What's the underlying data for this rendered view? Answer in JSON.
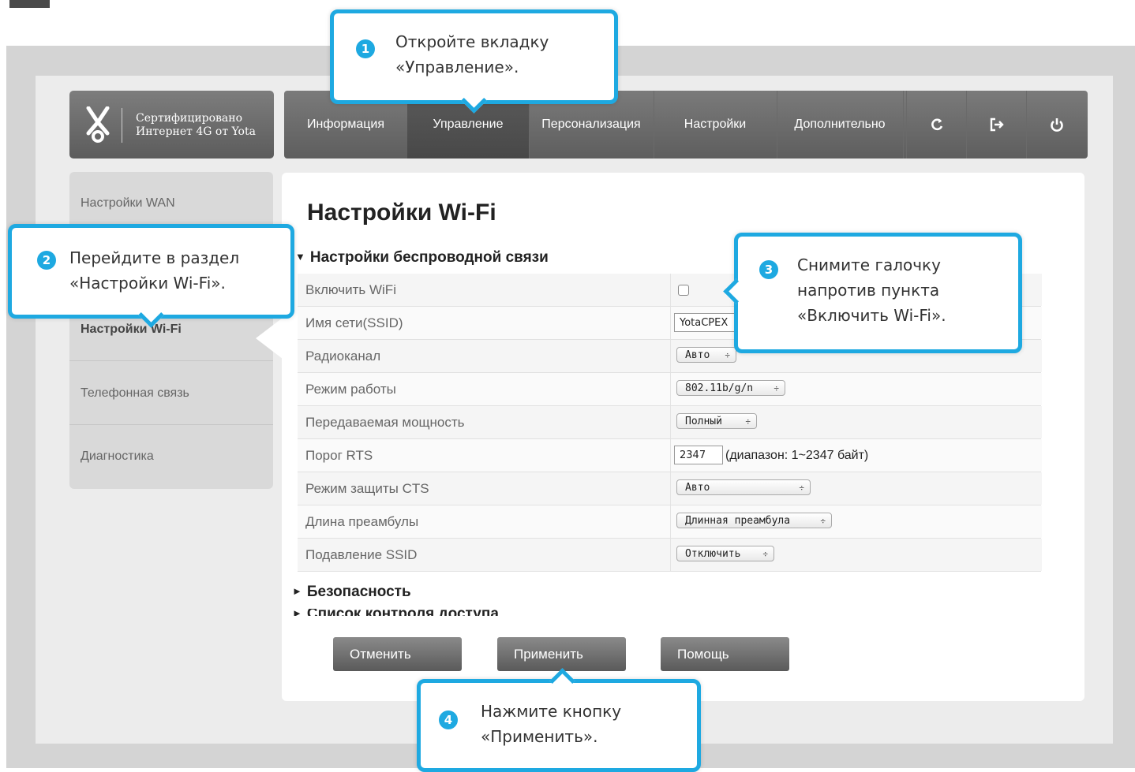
{
  "logo": {
    "line1": "Сертифицировано",
    "line2": "Интернет 4G от Yota"
  },
  "topnav": {
    "tabs": [
      {
        "label": "Информация"
      },
      {
        "label": "Управление"
      },
      {
        "label": "Персонализация"
      },
      {
        "label": "Настройки"
      },
      {
        "label": "Дополнительно"
      }
    ],
    "active_tab": "Управление",
    "icons": [
      "refresh-icon",
      "logout-icon",
      "power-icon"
    ]
  },
  "sidebar": {
    "items": [
      {
        "label": "Настройки WAN"
      },
      {
        "label": "Настройки Wi-Fi"
      },
      {
        "label": "Телефонная связь"
      },
      {
        "label": "Диагностика"
      }
    ],
    "active_item": "Настройки Wi-Fi"
  },
  "main": {
    "title": "Настройки Wi-Fi",
    "section_wireless": "Настройки беспроводной связи",
    "section_security": "Безопасность",
    "section_acl": "Список контроля доступа",
    "rows": [
      {
        "label": "Включить WiFi",
        "checked": false
      },
      {
        "label": "Имя сети(SSID)",
        "value": "YotaCPEX"
      },
      {
        "label": "Радиоканал",
        "value": "Авто"
      },
      {
        "label": "Режим работы",
        "value": "802.11b/g/n"
      },
      {
        "label": "Передаваемая мощность",
        "value": "Полный"
      },
      {
        "label": "Порог RTS",
        "value": "2347",
        "note": "(диапазон: 1~2347 байт)"
      },
      {
        "label": "Режим защиты CTS",
        "value": "Авто"
      },
      {
        "label": "Длина преамбулы",
        "value": "Длинная преамбула"
      },
      {
        "label": "Подавление SSID",
        "value": "Отключить"
      }
    ],
    "select_arrow": "÷"
  },
  "buttons": {
    "cancel": "Отменить",
    "apply": "Применить",
    "help": "Помощь"
  },
  "callouts": [
    {
      "num": "1",
      "line1": "Откройте вкладку",
      "line2": "«Управление»."
    },
    {
      "num": "2",
      "line1": "Перейдите в раздел",
      "line2": "«Настройки Wi-Fi»."
    },
    {
      "num": "3",
      "line1": "Снимите галочку",
      "line2": "напротив пункта",
      "line3": "«Включить Wi-Fi»."
    },
    {
      "num": "4",
      "line1": "Нажмите кнопку",
      "line2": "«Применить»."
    }
  ],
  "colors": {
    "accent": "#1ea9e1",
    "nav_bg": "#6a6a6a",
    "button_bg": "#707070"
  }
}
